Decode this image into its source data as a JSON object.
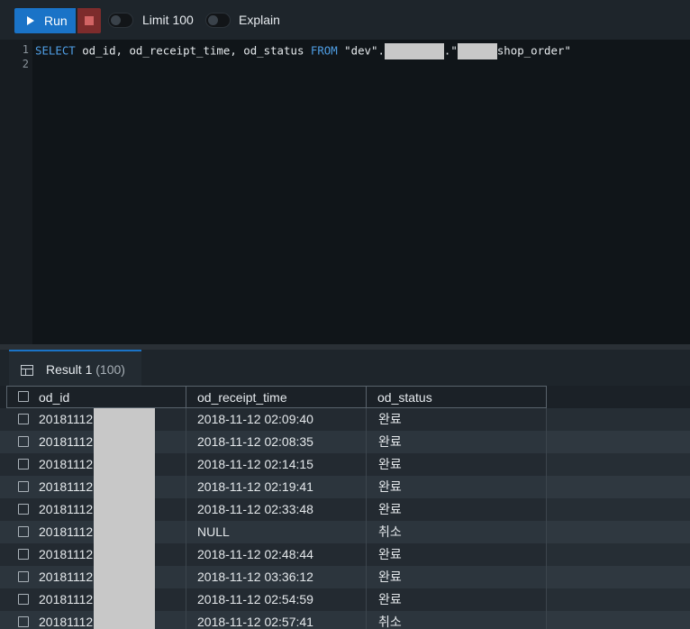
{
  "toolbar": {
    "run_label": "Run",
    "limit_label": "Limit 100",
    "explain_label": "Explain",
    "run_color": "#1a73c7",
    "stop_color": "#7d2c2c"
  },
  "editor": {
    "line_numbers": [
      "1",
      "2"
    ],
    "query": {
      "kw_select": "SELECT",
      "columns": " od_id, od_receipt_time, od_status ",
      "kw_from": "FROM",
      "schema": " \"dev\".",
      "dot_quote": ".\"",
      "table": "shop_order\""
    }
  },
  "results": {
    "tab_label": "Result 1",
    "tab_count": "(100)",
    "columns": [
      "od_id",
      "od_receipt_time",
      "od_status"
    ],
    "rows": [
      {
        "od_id": "20181112",
        "od_receipt_time": "2018-11-12 02:09:40",
        "od_status": "완료"
      },
      {
        "od_id": "20181112",
        "od_receipt_time": "2018-11-12 02:08:35",
        "od_status": "완료"
      },
      {
        "od_id": "20181112",
        "od_receipt_time": "2018-11-12 02:14:15",
        "od_status": "완료"
      },
      {
        "od_id": "20181112",
        "od_receipt_time": "2018-11-12 02:19:41",
        "od_status": "완료"
      },
      {
        "od_id": "20181112",
        "od_receipt_time": "2018-11-12 02:33:48",
        "od_status": "완료"
      },
      {
        "od_id": "20181112",
        "od_receipt_time": "NULL",
        "od_status": "취소"
      },
      {
        "od_id": "20181112",
        "od_receipt_time": "2018-11-12 02:48:44",
        "od_status": "완료"
      },
      {
        "od_id": "20181112",
        "od_receipt_time": "2018-11-12 03:36:12",
        "od_status": "완료"
      },
      {
        "od_id": "20181112",
        "od_receipt_time": "2018-11-12 02:54:59",
        "od_status": "완료"
      },
      {
        "od_id": "20181112",
        "od_receipt_time": "2018-11-12 02:57:41",
        "od_status": "취소"
      }
    ]
  }
}
